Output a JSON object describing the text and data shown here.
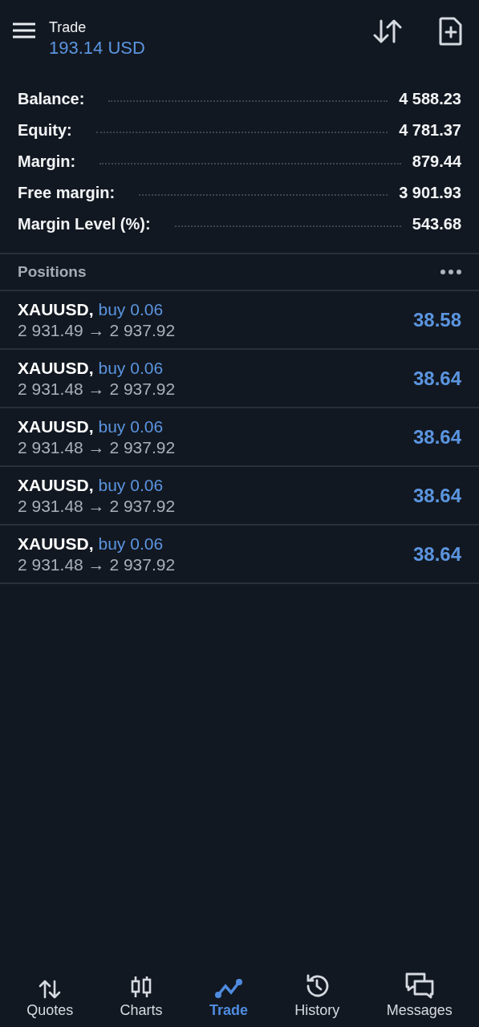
{
  "header": {
    "title": "Trade",
    "balance": "193.14 USD"
  },
  "summary": [
    {
      "label": "Balance:",
      "value": "4 588.23"
    },
    {
      "label": "Equity:",
      "value": "4 781.37"
    },
    {
      "label": "Margin:",
      "value": "879.44"
    },
    {
      "label": "Free margin:",
      "value": "3 901.93"
    },
    {
      "label": "Margin Level (%):",
      "value": "543.68"
    }
  ],
  "positions": {
    "title": "Positions",
    "items": [
      {
        "symbol": "XAUUSD,",
        "order": "buy 0.06",
        "prices": "2 931.49 → 2 937.92",
        "profit": "38.58"
      },
      {
        "symbol": "XAUUSD,",
        "order": "buy 0.06",
        "prices": "2 931.48 → 2 937.92",
        "profit": "38.64"
      },
      {
        "symbol": "XAUUSD,",
        "order": "buy 0.06",
        "prices": "2 931.48 → 2 937.92",
        "profit": "38.64"
      },
      {
        "symbol": "XAUUSD,",
        "order": "buy 0.06",
        "prices": "2 931.48 → 2 937.92",
        "profit": "38.64"
      },
      {
        "symbol": "XAUUSD,",
        "order": "buy 0.06",
        "prices": "2 931.48 → 2 937.92",
        "profit": "38.64"
      }
    ]
  },
  "nav": [
    {
      "label": "Quotes",
      "kind": "quotes",
      "selected": false
    },
    {
      "label": "Charts",
      "kind": "charts",
      "selected": false
    },
    {
      "label": "Trade",
      "kind": "trade",
      "selected": true
    },
    {
      "label": "History",
      "kind": "history",
      "selected": false
    },
    {
      "label": "Messages",
      "kind": "messages",
      "selected": false
    }
  ]
}
